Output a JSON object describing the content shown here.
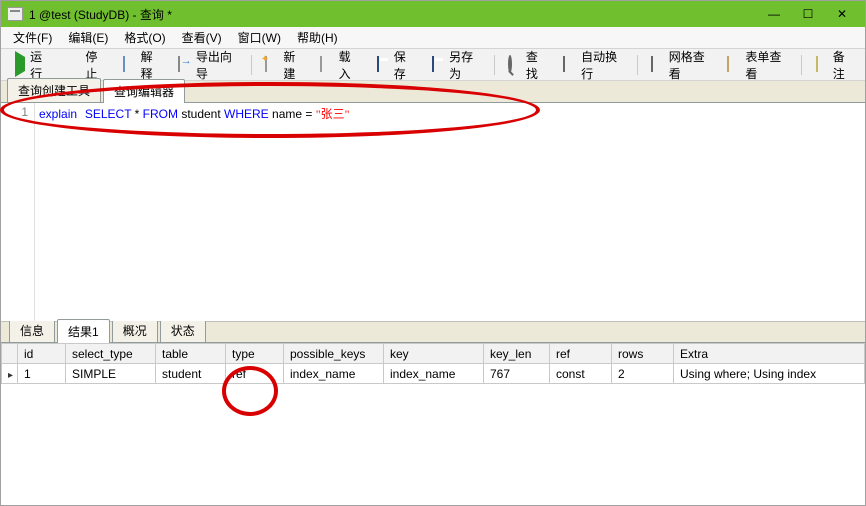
{
  "window": {
    "title": "1 @test (StudyDB) - 查询 *"
  },
  "menu": {
    "file": "文件(F)",
    "edit": "编辑(E)",
    "format": "格式(O)",
    "view": "查看(V)",
    "window": "窗口(W)",
    "help": "帮助(H)"
  },
  "toolbar": {
    "run": "运行",
    "stop": "停止",
    "explain": "解释",
    "export_wizard": "导出向导",
    "new": "新建",
    "load": "载入",
    "save": "保存",
    "save_as": "另存为",
    "find": "查找",
    "auto_wrap": "自动换行",
    "grid_view": "网格查看",
    "form_view": "表单查看",
    "note": "备注"
  },
  "editor_tabs": {
    "builder": "查询创建工具",
    "editor": "查询编辑器"
  },
  "editor": {
    "line_num": "1",
    "sql": {
      "kw1": "explain",
      "kw2": "SELECT",
      "star": " * ",
      "kw3": "FROM",
      "tbl": " student ",
      "kw4": "WHERE",
      "col": " name = ",
      "str": "\"张三\""
    }
  },
  "result_tabs": {
    "info": "信息",
    "result1": "结果1",
    "profile": "概况",
    "status": "状态"
  },
  "grid": {
    "headers": {
      "id": "id",
      "select_type": "select_type",
      "table": "table",
      "type": "type",
      "possible_keys": "possible_keys",
      "key": "key",
      "key_len": "key_len",
      "ref": "ref",
      "rows": "rows",
      "extra": "Extra"
    },
    "row1": {
      "id": "1",
      "select_type": "SIMPLE",
      "table": "student",
      "type": "ref",
      "possible_keys": "index_name",
      "key": "index_name",
      "key_len": "767",
      "ref": "const",
      "rows": "2",
      "extra": "Using where; Using index"
    }
  }
}
